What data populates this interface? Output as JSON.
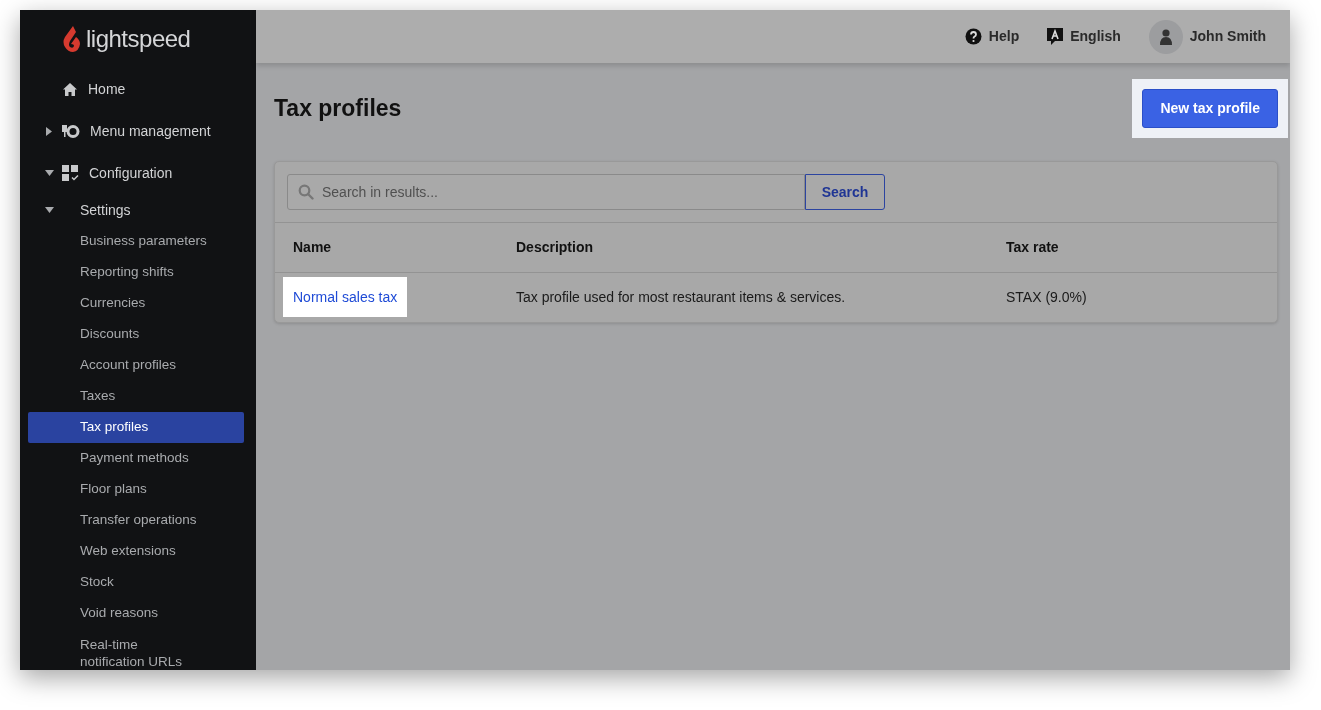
{
  "logo": {
    "text": "lightspeed"
  },
  "sidebar": {
    "items": [
      {
        "label": "Home",
        "kind": "link"
      },
      {
        "label": "Menu management",
        "kind": "group",
        "expanded": false
      },
      {
        "label": "Configuration",
        "kind": "group",
        "expanded": true,
        "children": [
          {
            "label": "Settings",
            "kind": "group",
            "expanded": true,
            "children": [
              {
                "label": "Business parameters",
                "selected": false
              },
              {
                "label": "Reporting shifts",
                "selected": false
              },
              {
                "label": "Currencies",
                "selected": false
              },
              {
                "label": "Discounts",
                "selected": false
              },
              {
                "label": "Account profiles",
                "selected": false
              },
              {
                "label": "Taxes",
                "selected": false
              },
              {
                "label": "Tax profiles",
                "selected": true
              },
              {
                "label": "Payment methods",
                "selected": false
              },
              {
                "label": "Floor plans",
                "selected": false
              },
              {
                "label": "Transfer operations",
                "selected": false
              },
              {
                "label": "Web extensions",
                "selected": false
              },
              {
                "label": "Stock",
                "selected": false
              },
              {
                "label": "Void reasons",
                "selected": false
              },
              {
                "label": "Real-time notification URLs",
                "selected": false
              }
            ]
          }
        ]
      }
    ]
  },
  "topbar": {
    "help": "Help",
    "language": "English",
    "user": "John Smith"
  },
  "page": {
    "title": "Tax profiles",
    "new_button": {
      "label": "New tax profile",
      "highlighted": true
    }
  },
  "search": {
    "placeholder": "Search in results...",
    "button": "Search"
  },
  "table": {
    "columns": [
      "Name",
      "Description",
      "Tax rate"
    ],
    "rows": [
      {
        "name": "Normal sales tax",
        "highlighted": true,
        "description": "Tax profile used for most restaurant items & services.",
        "tax_rate": "STAX (9.0%)"
      }
    ]
  }
}
